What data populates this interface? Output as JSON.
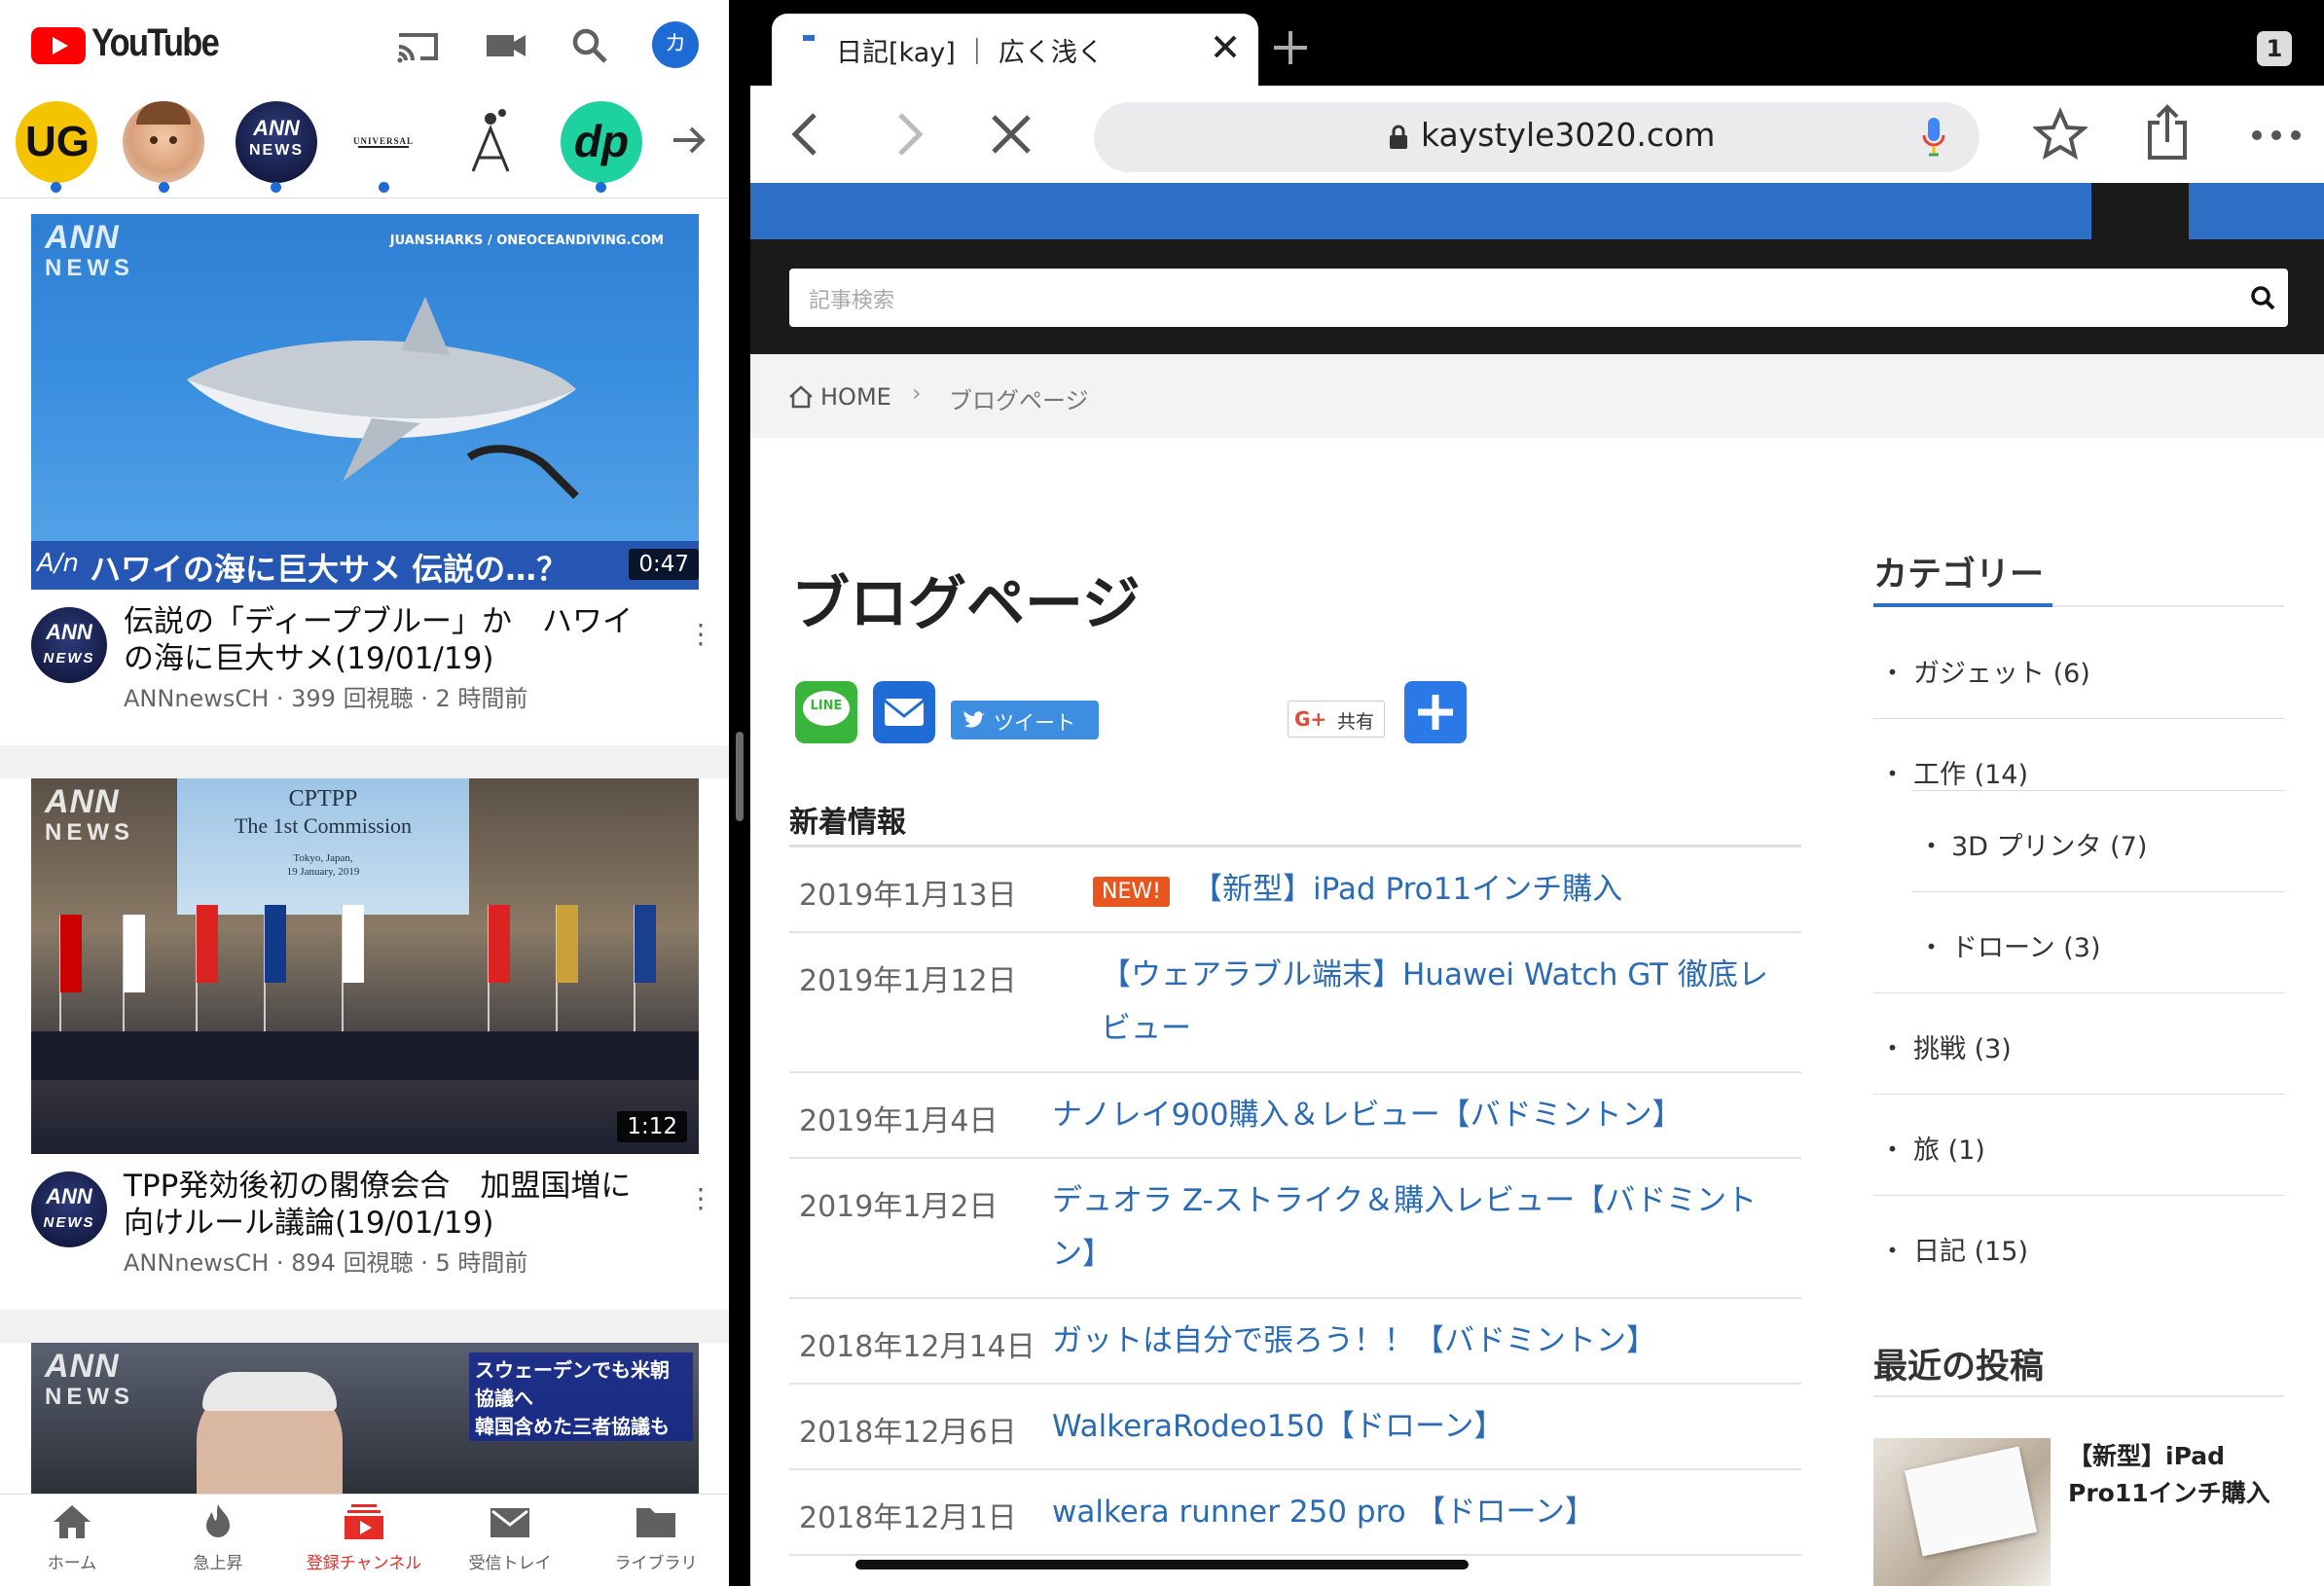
{
  "youtube": {
    "logo_text": "YouTube",
    "account_initial": "カ",
    "channels": [
      "UG",
      "ANN NEWS",
      "UNIVERSAL",
      "dp"
    ],
    "videos": [
      {
        "thumb_text_top": "JUANSHARKS / ONEOCEANDIVING.COM",
        "ann_big": "ANN",
        "ann_small": "NEWS",
        "caption_prefix": "A/n",
        "caption": "ハワイの海に巨大サメ 伝説の…？",
        "duration": "0:47",
        "title": "伝説の「ディープブルー」か　ハワイの海に巨大サメ(19/01/19)",
        "meta": "ANNnewsCH · 399 回視聴 · 2 時間前"
      },
      {
        "banner_1": "CPTPP",
        "banner_2": "The 1st Commission",
        "banner_3": "Tokyo, Japan,",
        "banner_4": "19 January, 2019",
        "ann_big": "ANN",
        "ann_small": "NEWS",
        "duration": "1:12",
        "title": "TPP発効後初の閣僚会合　加盟国増に向けルール議論(19/01/19)",
        "meta": "ANNnewsCH · 894 回視聴 · 5 時間前"
      },
      {
        "ann_big": "ANN",
        "ann_small": "NEWS",
        "caption_line1": "スウェーデンでも米朝協議へ",
        "caption_line2": "韓国含めた三者協議も"
      }
    ],
    "channel_avatar_text_1": "ANN",
    "channel_avatar_text_2": "NEWS",
    "nav": [
      {
        "label": "ホーム"
      },
      {
        "label": "急上昇"
      },
      {
        "label": "登録チャンネル"
      },
      {
        "label": "受信トレイ"
      },
      {
        "label": "ライブラリ"
      }
    ]
  },
  "browser": {
    "tab_count": "1",
    "tab_title": "日記[kay] ｜ 広く浅く",
    "url": "kaystyle3020.com",
    "site": {
      "search_placeholder": "記事検索",
      "crumb_home": "HOME",
      "crumb_current": "ブログページ",
      "page_title": "ブログページ",
      "share_line": "LINE",
      "share_tweet": "ツイート",
      "share_gplus": "共有",
      "news_heading": "新着情報",
      "new_badge": "NEW!",
      "posts": [
        {
          "date": "2019年1月13日",
          "title": "【新型】iPad Pro11インチ購入"
        },
        {
          "date": "2019年1月12日",
          "title": "【ウェアラブル端末】Huawei Watch GT 徹底レビュー"
        },
        {
          "date": "2019年1月4日",
          "title": "ナノレイ900購入＆レビュー【バドミントン】"
        },
        {
          "date": "2019年1月2日",
          "title": "デュオラ Z-ストライク＆購入レビュー【バドミントン】"
        },
        {
          "date": "2018年12月14日",
          "title": "ガットは自分で張ろう！！【バドミントン】"
        },
        {
          "date": "2018年12月6日",
          "title": "WalkeraRodeo150【ドローン】"
        },
        {
          "date": "2018年12月1日",
          "title": "walkera runner 250 pro 【ドローン】"
        }
      ],
      "category_heading": "カテゴリー",
      "categories": [
        {
          "label": "ガジェット (6)"
        },
        {
          "label": "工作 (14)"
        },
        {
          "label": "3D プリンタ (7)"
        },
        {
          "label": "ドローン (3)"
        },
        {
          "label": "挑戦 (3)"
        },
        {
          "label": "旅 (1)"
        },
        {
          "label": "日記 (15)"
        }
      ],
      "recent_heading": "最近の投稿",
      "recent_title": "【新型】iPad Pro11インチ購入"
    }
  },
  "colors": {
    "youtube_red": "#ff0000",
    "link_blue": "#2a6bb4",
    "site_banner_blue": "#2e6ec4",
    "new_badge": "#e8551f"
  }
}
